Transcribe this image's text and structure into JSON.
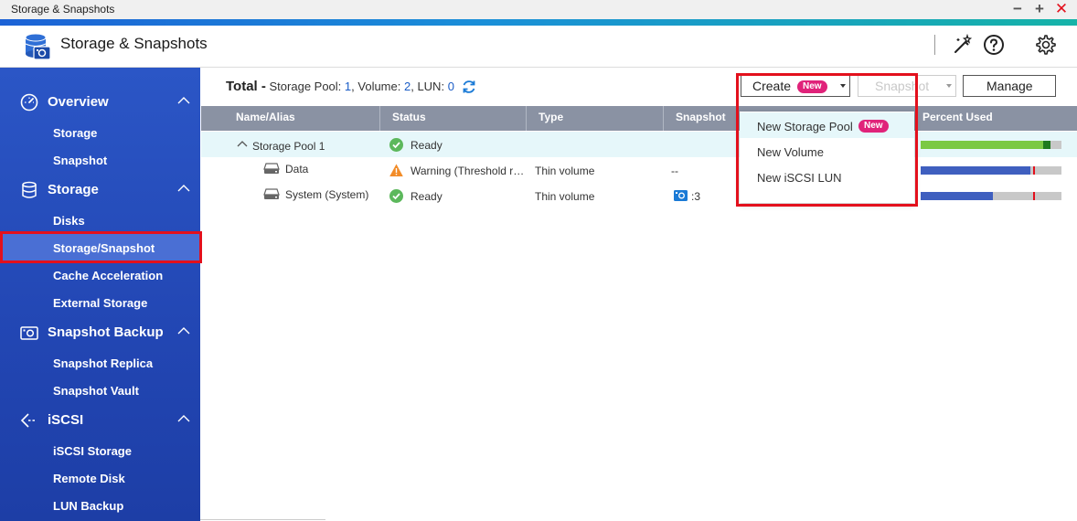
{
  "window": {
    "title": "Storage & Snapshots",
    "minimize": "−",
    "maximize": "+",
    "close": "✕"
  },
  "app": {
    "title": "Storage & Snapshots"
  },
  "header_icons": [
    "magic-wand-icon",
    "help-icon",
    "settings-icon"
  ],
  "sidebar": {
    "sections": [
      {
        "label": "Overview",
        "icon": "speedometer-icon",
        "items": [
          "Storage",
          "Snapshot"
        ]
      },
      {
        "label": "Storage",
        "icon": "database-icon",
        "items": [
          "Disks",
          "Storage/Snapshot",
          "Cache Acceleration",
          "External Storage"
        ]
      },
      {
        "label": "Snapshot Backup",
        "icon": "camera-icon",
        "items": [
          "Snapshot Replica",
          "Snapshot Vault"
        ]
      },
      {
        "label": "iSCSI",
        "icon": "iscsi-icon",
        "items": [
          "iSCSI Storage",
          "Remote Disk",
          "LUN Backup"
        ]
      }
    ],
    "active_item": "Storage/Snapshot"
  },
  "totals": {
    "prefix": "Total -",
    "pool_label": "Storage Pool:",
    "pool_count": "1",
    "volume_label": ", Volume:",
    "volume_count": "2",
    "lun_label": ", LUN:",
    "lun_count": "0"
  },
  "toolbar": {
    "create": "Create",
    "new_badge": "New",
    "snapshot": "Snapshot",
    "manage": "Manage"
  },
  "dropdown": {
    "items": [
      "New Storage Pool",
      "New Volume",
      "New iSCSI LUN"
    ],
    "badge": "New"
  },
  "table": {
    "columns": [
      "Name/Alias",
      "Status",
      "Type",
      "Snapshot",
      "Percent Used"
    ],
    "rows": [
      {
        "name": "Storage Pool 1",
        "status": "Ready",
        "status_kind": "ok",
        "type": "",
        "snapshot": "",
        "used": 0.92,
        "reserved": 0.05
      },
      {
        "name": "Data",
        "status": "Warning (Threshold r…",
        "status_kind": "warning",
        "type": "Thin volume",
        "snapshot": "--",
        "used": 0.78
      },
      {
        "name": "System (System)",
        "status": "Ready",
        "status_kind": "ok",
        "type": "Thin volume",
        "snapshot": ":3",
        "used": 0.51
      }
    ]
  },
  "colors": {
    "accent_blue": "#1a5cc6",
    "badge_pink": "#e0237a",
    "highlight_red": "#e3101c",
    "pool_green": "#7ac943",
    "volume_blue": "#3f5fbf"
  }
}
